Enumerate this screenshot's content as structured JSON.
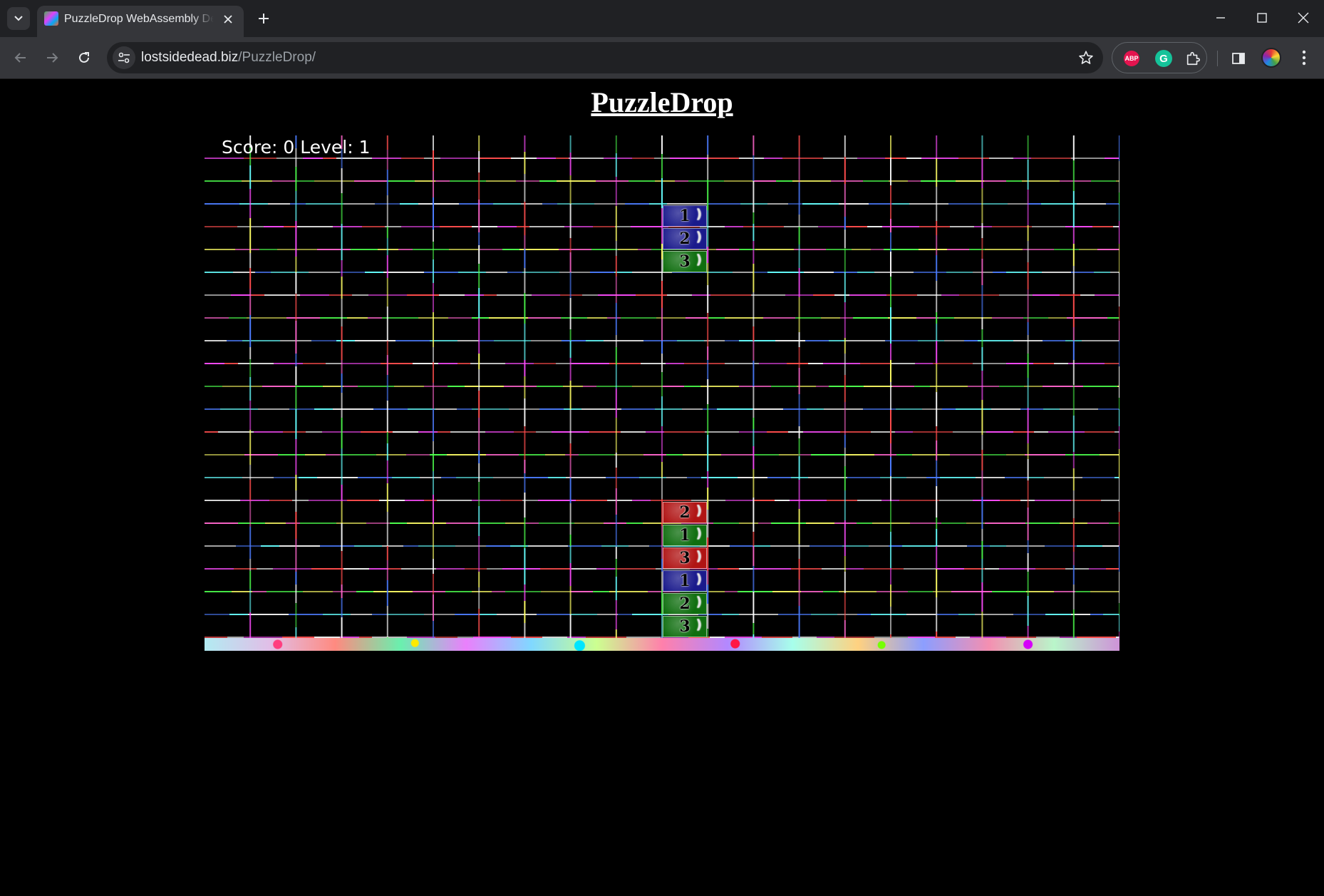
{
  "browser": {
    "tab_title": "PuzzleDrop WebAssembly Demo",
    "url_host": "lostsidedead.biz",
    "url_path": "/PuzzleDrop/",
    "extensions": {
      "abp_label": "ABP",
      "grammarly_label": "G"
    }
  },
  "page": {
    "title": "PuzzleDrop"
  },
  "game": {
    "hud": "Score: 0 Level: 1",
    "score": 0,
    "level": 1,
    "grid": {
      "columns": 20,
      "rows": 22
    },
    "falling_piece": [
      {
        "label": "1",
        "color": "#1a1a8c",
        "col": 10,
        "row": 3
      },
      {
        "label": "2",
        "color": "#1a1a8c",
        "col": 10,
        "row": 4
      },
      {
        "label": "3",
        "color": "#0f6e0f",
        "col": 10,
        "row": 5
      }
    ],
    "stack": [
      {
        "label": "2",
        "color": "#b01414",
        "col": 10,
        "row": 16
      },
      {
        "label": "1",
        "color": "#0f6e0f",
        "col": 10,
        "row": 17
      },
      {
        "label": "3",
        "color": "#b01414",
        "col": 10,
        "row": 18
      },
      {
        "label": "1",
        "color": "#1a1a8c",
        "col": 10,
        "row": 19
      },
      {
        "label": "2",
        "color": "#0f6e0f",
        "col": 10,
        "row": 20
      },
      {
        "label": "3",
        "color": "#0f6e0f",
        "col": 10,
        "row": 21
      }
    ]
  }
}
